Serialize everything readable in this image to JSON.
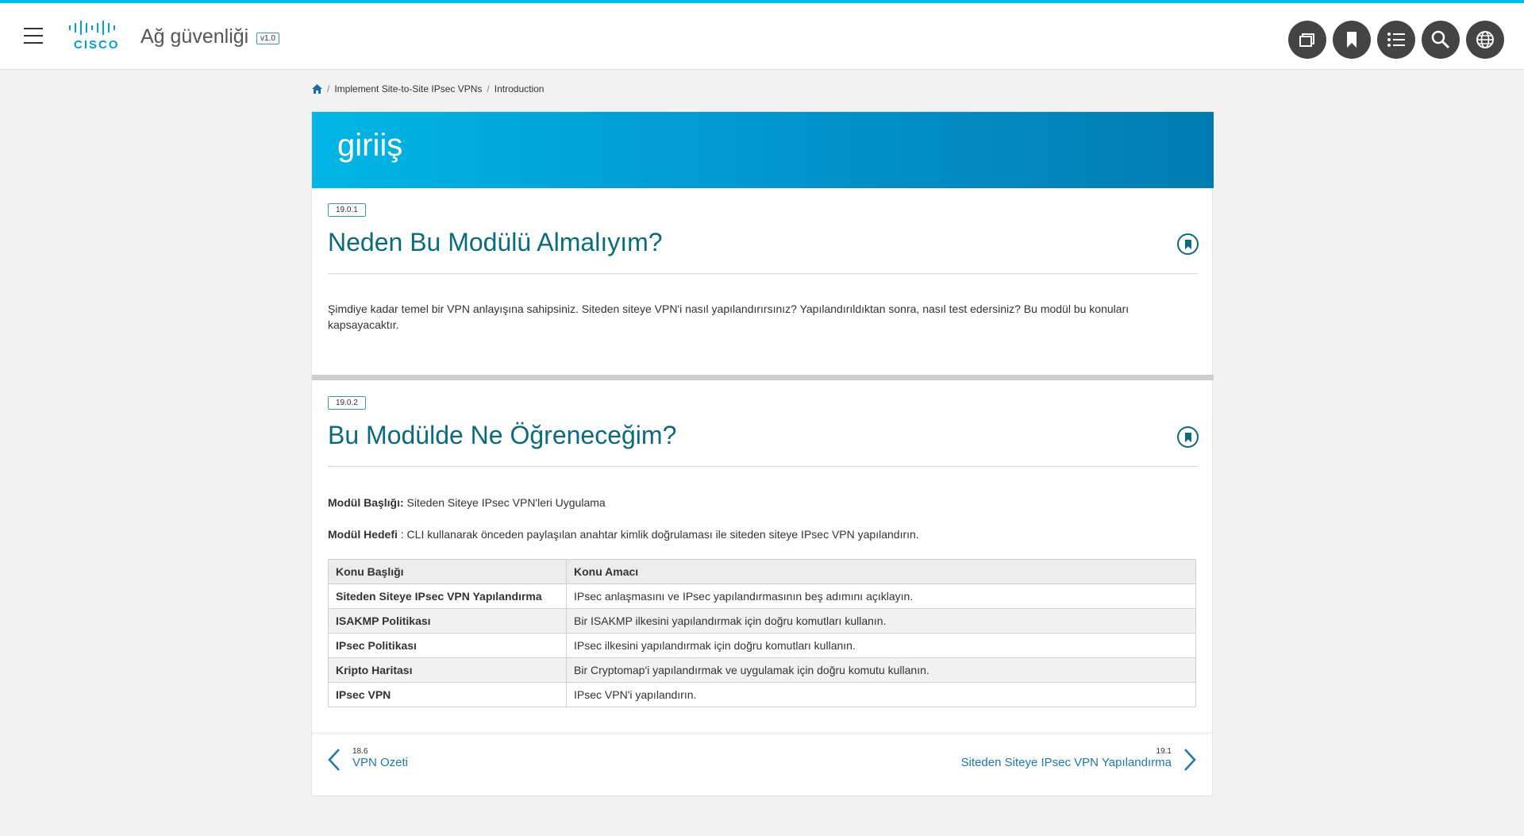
{
  "header": {
    "app_title": "Ağ güvenliği",
    "version": "v1.0",
    "logo_text": "CISCO",
    "buttons": [
      "pages-icon",
      "bookmark-icon",
      "list-icon",
      "search-icon",
      "globe-icon"
    ]
  },
  "breadcrumb": {
    "home_icon": "home-icon",
    "items": [
      "Implement Site-to-Site IPsec VPNs",
      "Introduction"
    ]
  },
  "banner": {
    "title": "giriiş"
  },
  "sections": [
    {
      "badge": "19.0.1",
      "title": "Neden Bu Modülü Almalıyım?",
      "body": "Şimdiye kadar temel bir VPN anlayışına sahipsiniz. Siteden siteye VPN'i nasıl yapılandırırsınız? Yapılandırıldıktan sonra, nasıl test edersiniz? Bu modül bu konuları kapsayacaktır."
    },
    {
      "badge": "19.0.2",
      "title": "Bu Modülde Ne Öğreneceğim?",
      "module_title_label": "Modül Başlığı:",
      "module_title_value": " Siteden Siteye IPsec VPN'leri Uygulama",
      "module_goal_label": "Modül Hedefi",
      "module_goal_value": " : CLI kullanarak önceden paylaşılan anahtar kimlik doğrulaması ile siteden siteye IPsec VPN yapılandırın."
    }
  ],
  "table": {
    "headers": [
      "Konu Başlığı",
      "Konu Amacı"
    ],
    "rows": [
      [
        "Siteden Siteye IPsec VPN Yapılandırma",
        "IPsec anlaşmasını ve IPsec yapılandırmasının beş adımını açıklayın."
      ],
      [
        "ISAKMP Politikası",
        "Bir ISAKMP ilkesini yapılandırmak için doğru komutları kullanın."
      ],
      [
        "IPsec Politikası",
        "IPsec ilkesini yapılandırmak için doğru komutları kullanın."
      ],
      [
        "Kripto Haritası",
        "Bir Cryptomap'i yapılandırmak ve uygulamak için doğru komutu kullanın."
      ],
      [
        "IPsec VPN",
        "IPsec VPN'i yapılandırın."
      ]
    ]
  },
  "nav": {
    "prev_num": "18.6",
    "prev_label": "VPN Ozeti",
    "next_num": "19.1",
    "next_label": "Siteden Siteye IPsec VPN Yapılandırma"
  },
  "colors": {
    "accent": "#00bceb",
    "title_teal": "#0a6b7c",
    "link": "#1a7aa8"
  }
}
